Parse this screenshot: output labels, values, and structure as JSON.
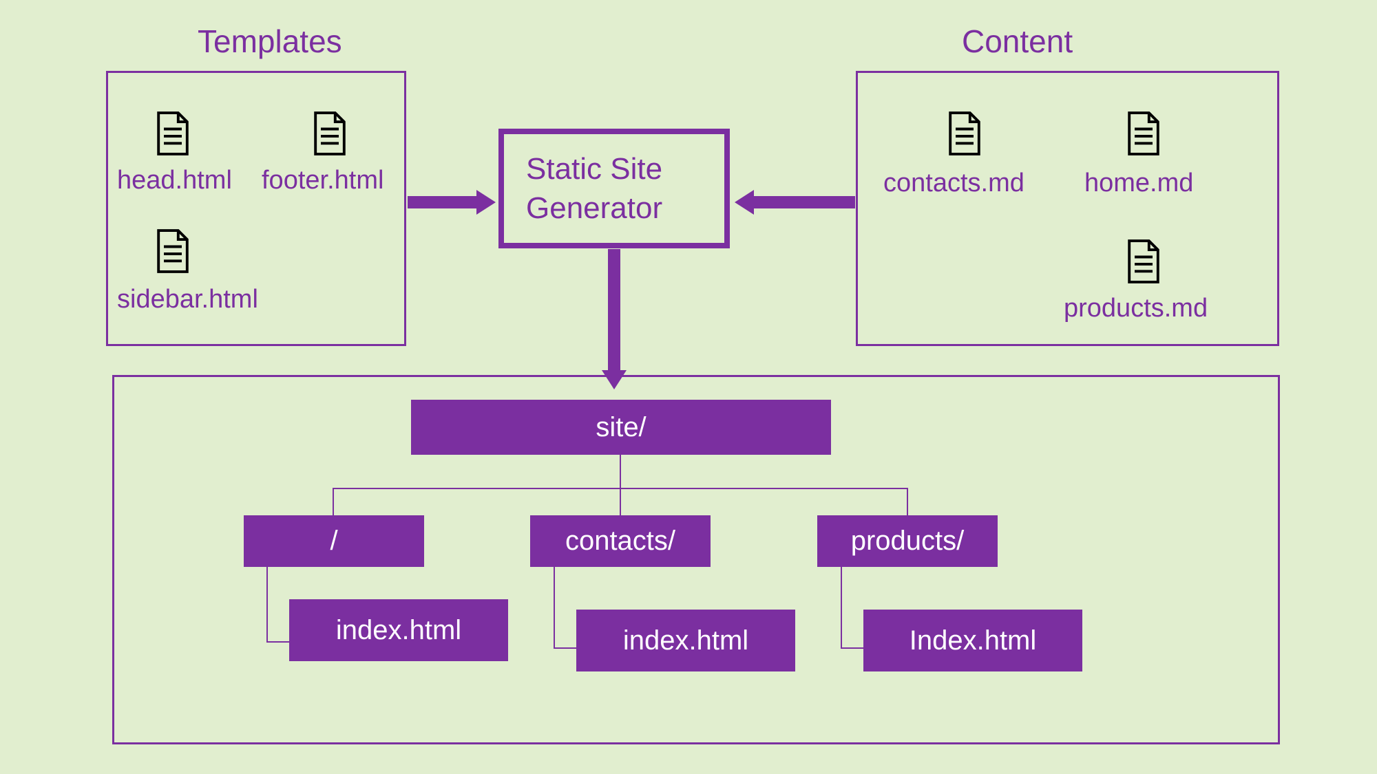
{
  "templates": {
    "title": "Templates",
    "files": [
      "head.html",
      "footer.html",
      "sidebar.html"
    ]
  },
  "content": {
    "title": "Content",
    "files": [
      "contacts.md",
      "home.md",
      "products.md"
    ]
  },
  "central": {
    "line1": "Static Site",
    "line2": "Generator"
  },
  "output": {
    "root": "site/",
    "dirs": [
      "/",
      "contacts/",
      "products/"
    ],
    "files": [
      "index.html",
      "index.html",
      "Index.html"
    ]
  }
}
